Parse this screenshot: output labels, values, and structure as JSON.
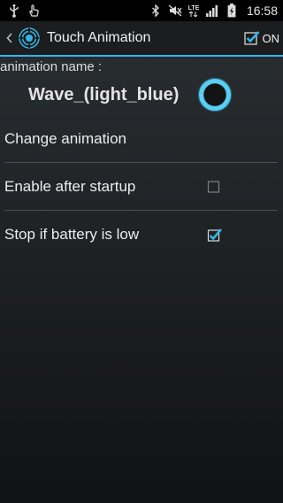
{
  "status_bar": {
    "time": "16:58",
    "network": "LTE",
    "icons": [
      "usb-icon",
      "touch-icon",
      "bluetooth-icon",
      "mute-icon",
      "lte-icon",
      "signal-icon",
      "battery-icon"
    ]
  },
  "action_bar": {
    "title": "Touch Animation",
    "toggle_label": "ON",
    "toggle_checked": true
  },
  "animation": {
    "name_label": "animation name :",
    "name_value": "Wave_(light_blue)"
  },
  "preferences": [
    {
      "label": "Change animation",
      "has_checkbox": false
    },
    {
      "label": "Enable after startup",
      "has_checkbox": true,
      "checked": false
    },
    {
      "label": "Stop if battery is low",
      "has_checkbox": true,
      "checked": true
    }
  ],
  "colors": {
    "accent": "#33b5e5",
    "background": "#1d2023"
  }
}
